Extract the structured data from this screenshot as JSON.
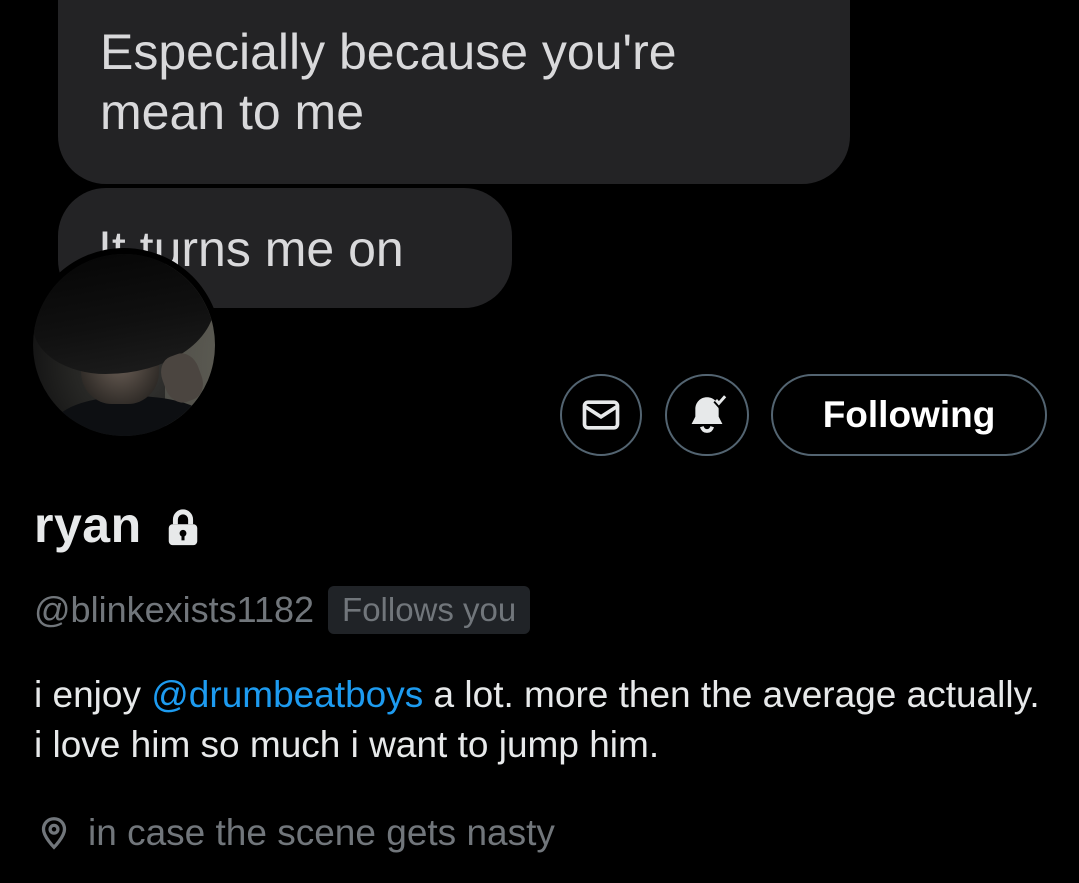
{
  "messages": [
    {
      "lines": [
        "Especially because you're",
        "mean to me"
      ]
    },
    {
      "lines": [
        "It turns me on"
      ]
    }
  ],
  "profile": {
    "name": "ryan",
    "handle": "@blinkexists1182",
    "follows_badge": "Follows you",
    "bio": {
      "before": "i enjoy ",
      "mention": "@drumbeatboys",
      "after": " a lot. more then the average actually. i love him so much i want to jump him."
    },
    "location": "in case the scene gets nasty",
    "protected_icon": "lock-icon"
  },
  "actions": {
    "message_icon": "envelope-icon",
    "notify_icon": "bell-icon",
    "follow_label": "Following"
  },
  "colors": {
    "background": "#000000",
    "bubble": "#232325",
    "mention": "#1d9bf0",
    "muted": "#71767b",
    "border": "#536471"
  }
}
